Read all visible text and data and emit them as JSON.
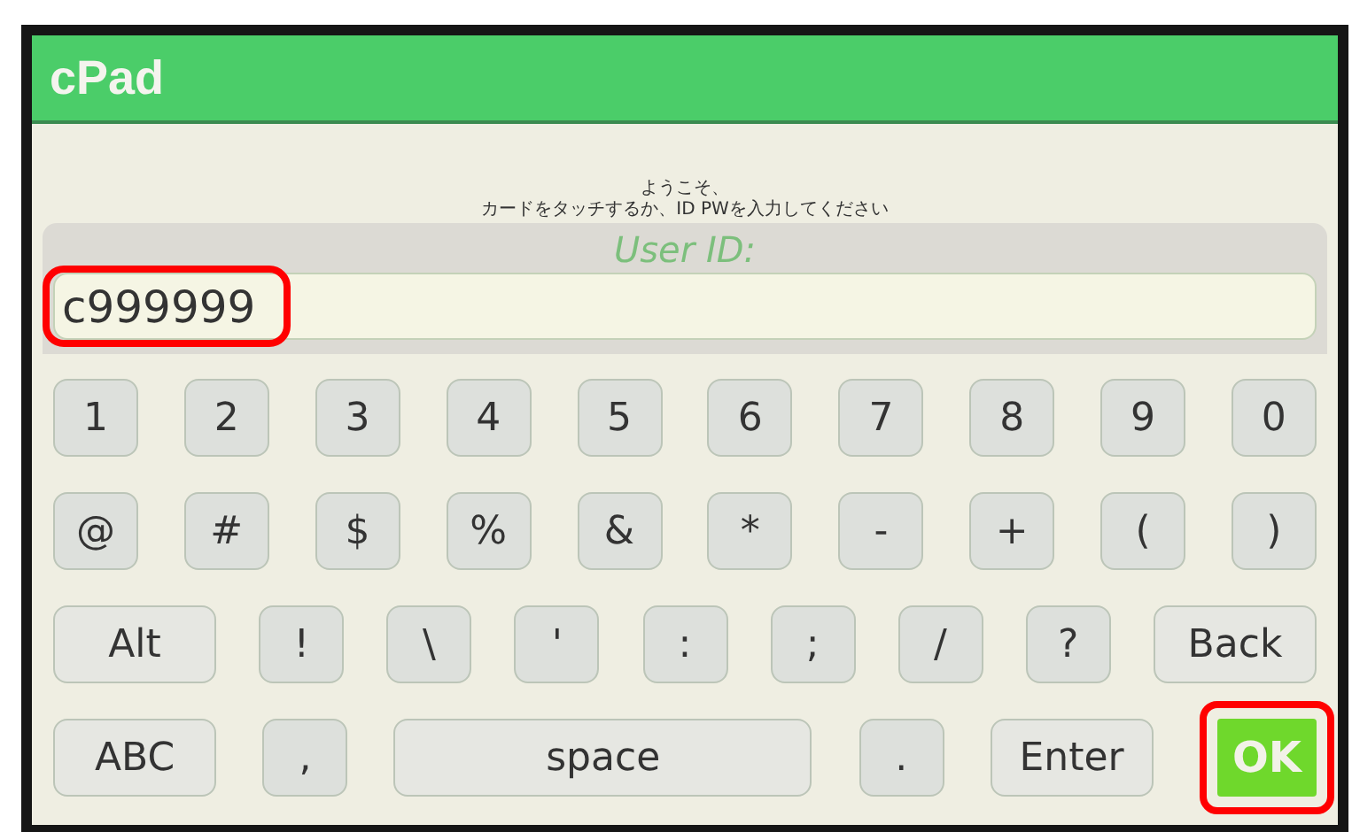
{
  "window": {
    "title": "cPad"
  },
  "welcome": [
    "ようこそ、",
    "カードをタッチするか、ID PWを入力してください"
  ],
  "login": {
    "label": "User ID:",
    "value": "c999999",
    "annotated": true
  },
  "keyboard": [
    [
      {
        "label": "1",
        "kind": "key"
      },
      {
        "label": "2",
        "kind": "key"
      },
      {
        "label": "3",
        "kind": "key"
      },
      {
        "label": "4",
        "kind": "key"
      },
      {
        "label": "5",
        "kind": "key"
      },
      {
        "label": "6",
        "kind": "key"
      },
      {
        "label": "7",
        "kind": "key"
      },
      {
        "label": "8",
        "kind": "key"
      },
      {
        "label": "9",
        "kind": "key"
      },
      {
        "label": "0",
        "kind": "key"
      }
    ],
    [
      {
        "label": "@",
        "kind": "key"
      },
      {
        "label": "#",
        "kind": "key"
      },
      {
        "label": "$",
        "kind": "key"
      },
      {
        "label": "%",
        "kind": "key"
      },
      {
        "label": "&",
        "kind": "key"
      },
      {
        "label": "*",
        "kind": "key"
      },
      {
        "label": "-",
        "kind": "key"
      },
      {
        "label": "+",
        "kind": "key"
      },
      {
        "label": "(",
        "kind": "key"
      },
      {
        "label": ")",
        "kind": "key"
      }
    ],
    [
      {
        "label": "Alt",
        "kind": "wide"
      },
      {
        "label": "!",
        "kind": "key"
      },
      {
        "label": "\\",
        "kind": "key"
      },
      {
        "label": "'",
        "kind": "key"
      },
      {
        "label": ":",
        "kind": "key"
      },
      {
        "label": ";",
        "kind": "key"
      },
      {
        "label": "/",
        "kind": "key"
      },
      {
        "label": "?",
        "kind": "key"
      },
      {
        "label": "Back",
        "kind": "wide"
      }
    ],
    [
      {
        "label": "ABC",
        "kind": "wide"
      },
      {
        "label": ",",
        "kind": "key"
      },
      {
        "label": "space",
        "kind": "space"
      },
      {
        "label": ".",
        "kind": "key"
      },
      {
        "label": "Enter",
        "kind": "wide"
      },
      {
        "label": "OK",
        "kind": "ok",
        "annotated": true
      }
    ]
  ]
}
